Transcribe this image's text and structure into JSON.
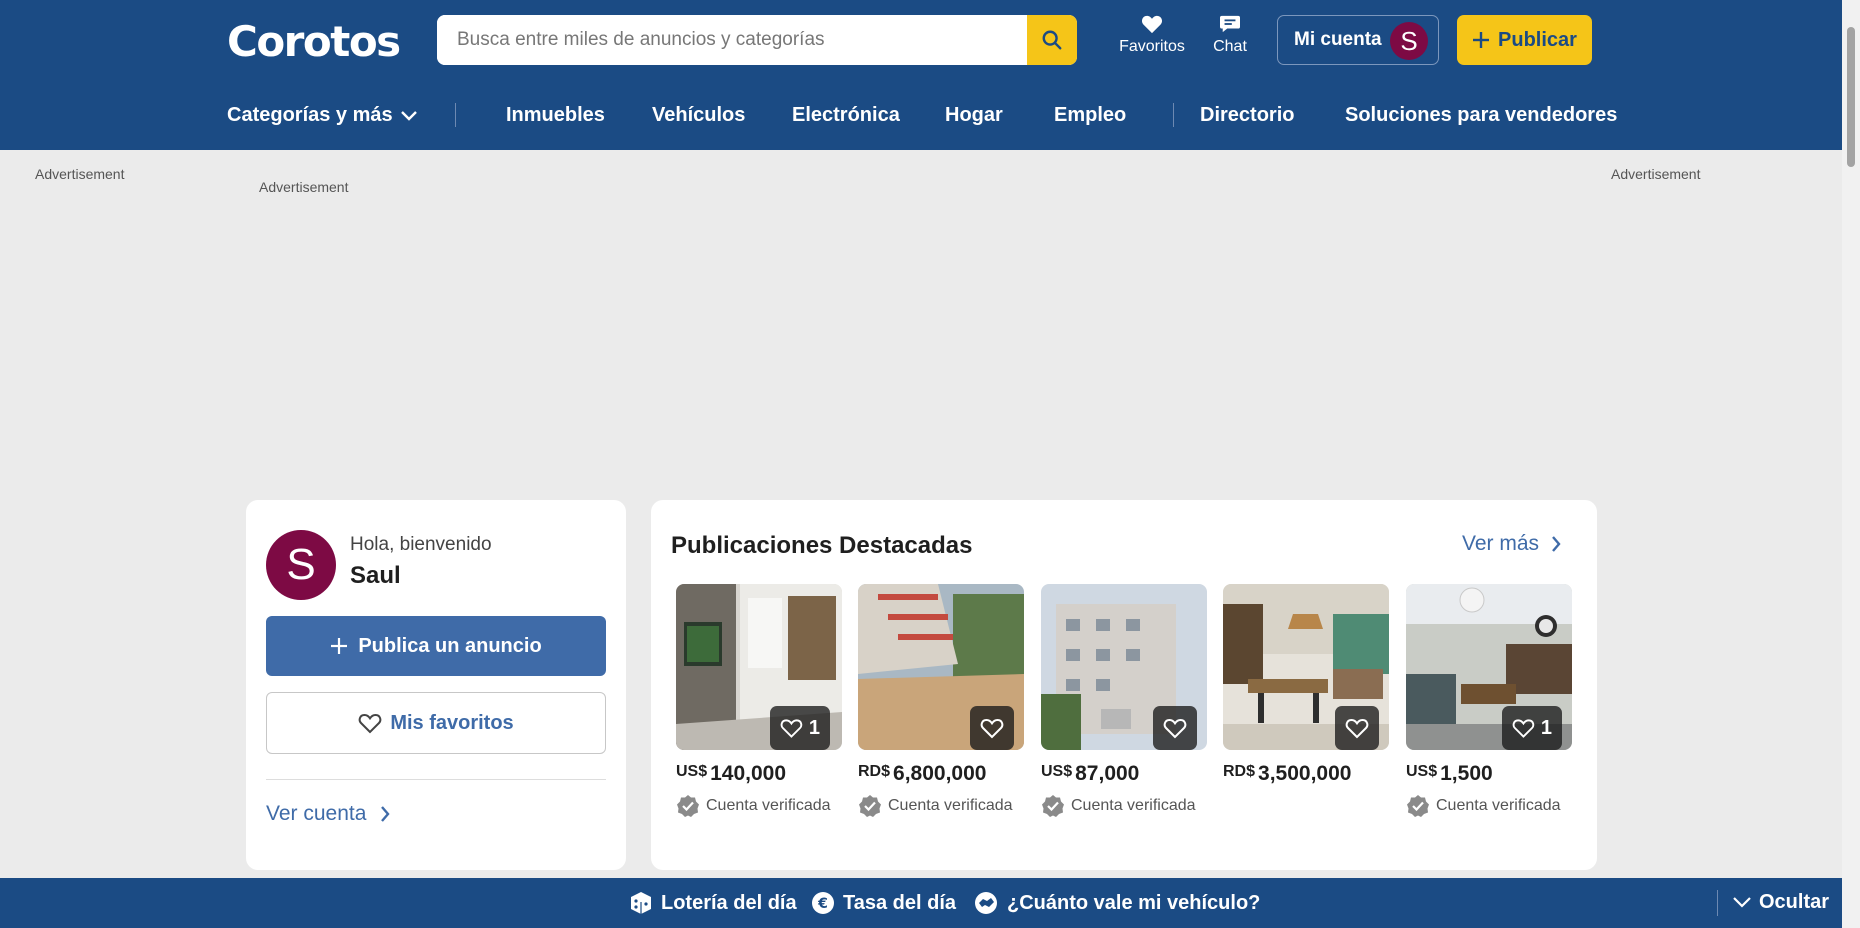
{
  "header": {
    "logo": "Corotos",
    "search_placeholder": "Busca entre miles de anuncios y categorías",
    "favorites_label": "Favoritos",
    "chat_label": "Chat",
    "account_label": "Mi cuenta",
    "account_initial": "S",
    "publish_label": "Publicar"
  },
  "nav": {
    "categories_label": "Categorías y más",
    "items": [
      "Inmuebles",
      "Vehículos",
      "Electrónica",
      "Hogar",
      "Empleo",
      "Directorio",
      "Soluciones para vendedores"
    ]
  },
  "ads": {
    "left": "Advertisement",
    "center": "Advertisement",
    "right": "Advertisement"
  },
  "welcome": {
    "initial": "S",
    "greeting": "Hola, bienvenido",
    "name": "Saul",
    "publish_button": "Publica un anuncio",
    "favorites_button": "Mis favoritos",
    "account_link": "Ver cuenta"
  },
  "featured": {
    "title": "Publicaciones Destacadas",
    "more_link": "Ver más",
    "items": [
      {
        "currency": "US$",
        "amount": "140,000",
        "favorites": "1",
        "verified": "Cuenta verificada"
      },
      {
        "currency": "RD$",
        "amount": "6,800,000",
        "favorites": "",
        "verified": "Cuenta verificada"
      },
      {
        "currency": "US$",
        "amount": "87,000",
        "favorites": "",
        "verified": "Cuenta verificada"
      },
      {
        "currency": "RD$",
        "amount": "3,500,000",
        "favorites": "",
        "verified": ""
      },
      {
        "currency": "US$",
        "amount": "1,500",
        "favorites": "1",
        "verified": "Cuenta verificada"
      }
    ]
  },
  "bottom_bar": {
    "lottery": "Lotería del día",
    "rate": "Tasa del día",
    "vehicle_value": "¿Cuánto vale mi vehículo?",
    "hide": "Ocultar"
  },
  "colors": {
    "brand_blue": "#1b4b84",
    "accent_yellow": "#f5c518",
    "link_blue": "#3f6ba8",
    "avatar": "#7d0a44"
  }
}
